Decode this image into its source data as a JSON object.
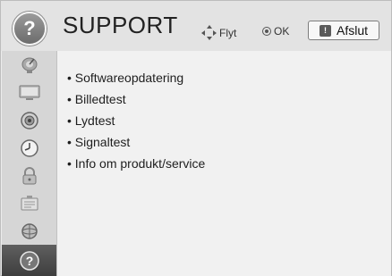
{
  "header": {
    "help_symbol": "?",
    "title": "SUPPORT",
    "move_hint": "Flyt",
    "ok_hint": "OK",
    "exit_label": "Afslut",
    "exit_key_symbol": "!"
  },
  "sidebar": {
    "items": [
      {
        "icon": "satellite-dish-icon"
      },
      {
        "icon": "monitor-icon"
      },
      {
        "icon": "speaker-icon"
      },
      {
        "icon": "clock-icon"
      },
      {
        "icon": "lock-icon"
      },
      {
        "icon": "options-icon"
      },
      {
        "icon": "network-icon"
      },
      {
        "icon": "help-icon",
        "active": true
      }
    ],
    "active_symbol": "?"
  },
  "menu": {
    "items": [
      {
        "label": "• Softwareopdatering"
      },
      {
        "label": "• Billedtest"
      },
      {
        "label": "• Lydtest"
      },
      {
        "label": "• Signaltest"
      },
      {
        "label": "• Info om produkt/service"
      }
    ]
  },
  "colors": {
    "frame_bg": "#ececec",
    "sidebar_bg": "#d6d6d6",
    "active_item_bg": "#4a4a4a",
    "text": "#1e1e1e"
  }
}
